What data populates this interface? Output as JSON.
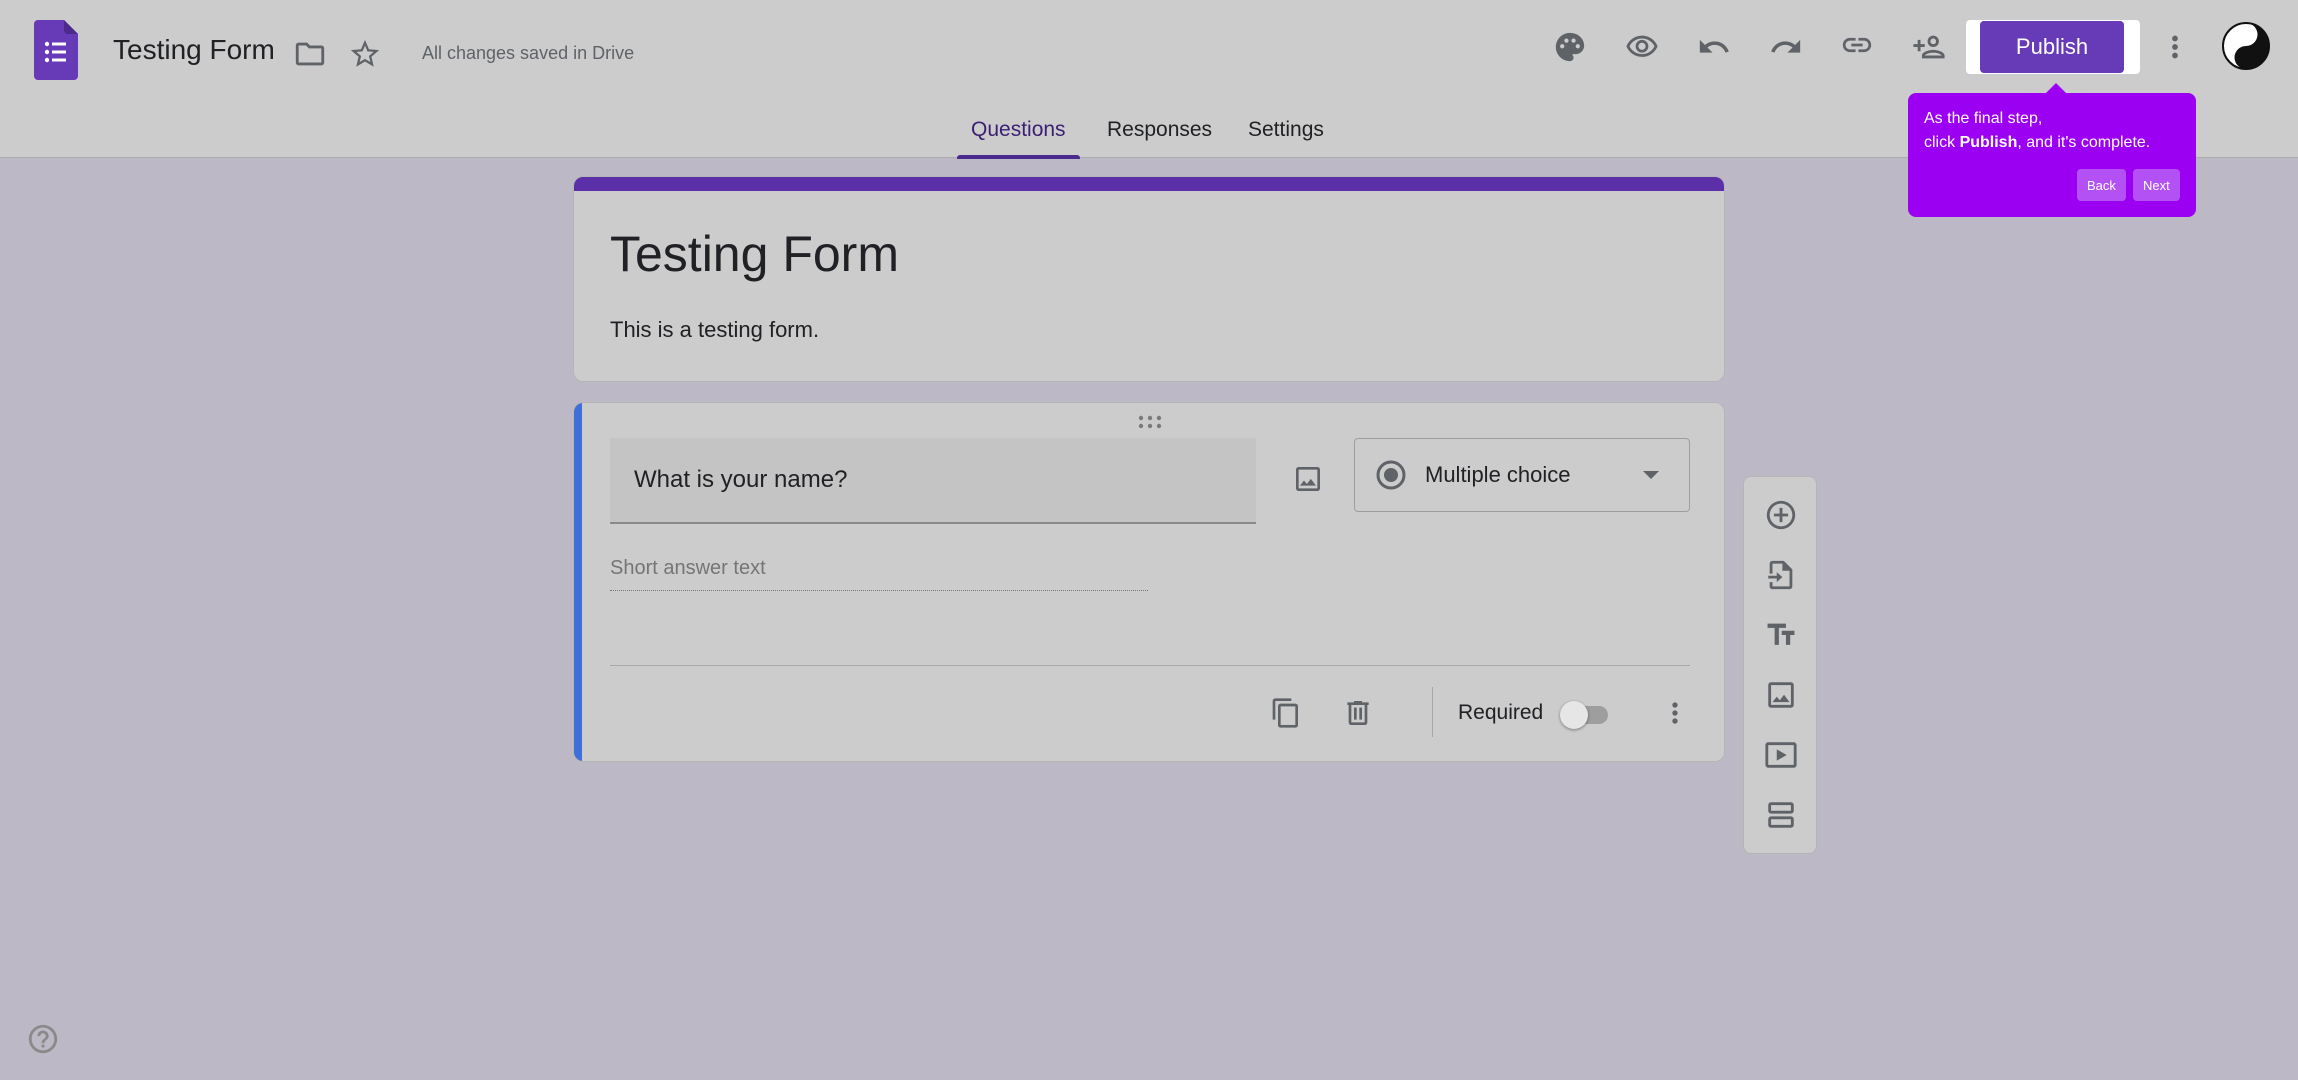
{
  "header": {
    "doc_title": "Testing Form",
    "saved_status": "All changes saved in Drive",
    "publish_label": "Publish"
  },
  "tabs": [
    {
      "label": "Questions",
      "active": true
    },
    {
      "label": "Responses",
      "active": false
    },
    {
      "label": "Settings",
      "active": false
    }
  ],
  "tooltip": {
    "line1": "As the final step,",
    "line2_pre": "click ",
    "line2_bold": "Publish",
    "line2_post": ", and it's complete.",
    "back_label": "Back",
    "next_label": "Next"
  },
  "form": {
    "title": "Testing Form",
    "description": "This is a testing form."
  },
  "question": {
    "text": "What is your name?",
    "type_label": "Multiple choice",
    "answer_placeholder": "Short answer text",
    "required_label": "Required",
    "required": false
  },
  "colors": {
    "accent": "#673ab7",
    "tooltip": "#9b00f2",
    "question_bar": "#3f6fd8"
  },
  "icons": {
    "header": [
      "forms-logo",
      "folder-icon",
      "star-icon",
      "palette-icon",
      "eye-icon",
      "undo-icon",
      "redo-icon",
      "link-icon",
      "add-person-icon",
      "more-vert-icon",
      "avatar"
    ],
    "side_toolbar": [
      "add-circle-icon",
      "import-icon",
      "title-icon",
      "image-icon",
      "video-icon",
      "section-icon"
    ]
  }
}
